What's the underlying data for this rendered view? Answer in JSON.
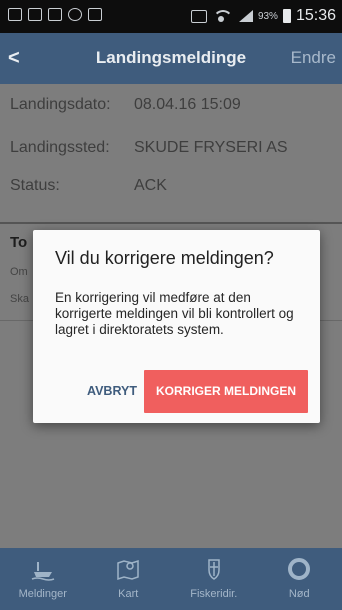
{
  "status_bar": {
    "battery_pct": "93%",
    "time": "15:36"
  },
  "app_bar": {
    "back_label": "<",
    "title": "Landingsmeldinge",
    "edit_label": "Endre"
  },
  "details": [
    {
      "label": "Landingsdato:",
      "value": "08.04.16 15:09"
    },
    {
      "label": "Landingssted:",
      "value": "SKUDE FRYSERI AS"
    },
    {
      "label": "Status:",
      "value": "ACK"
    }
  ],
  "underlying": {
    "title": "To",
    "line1": "Om",
    "line2": "Ska"
  },
  "dialog": {
    "title": "Vil du korrigere meldingen?",
    "body": "En korrigering vil medføre at den korrigerte meldingen vil bli kontrollert og lagret i direktoratets system.",
    "cancel_label": "AVBRYT",
    "confirm_label": "KORRIGER MELDINGEN"
  },
  "tab_bar": {
    "tabs": [
      {
        "label": "Meldinger",
        "icon": "fishing-boat-icon"
      },
      {
        "label": "Kart",
        "icon": "map-pin-icon"
      },
      {
        "label": "Fiskeridir.",
        "icon": "crest-icon"
      },
      {
        "label": "Nød",
        "icon": "lifebuoy-icon"
      }
    ]
  },
  "colors": {
    "app_bar": "#3f5c7d",
    "confirm_button": "#f05f5e",
    "cancel_text": "#3f5c7d",
    "overlay_content": "#7d7d7d"
  }
}
